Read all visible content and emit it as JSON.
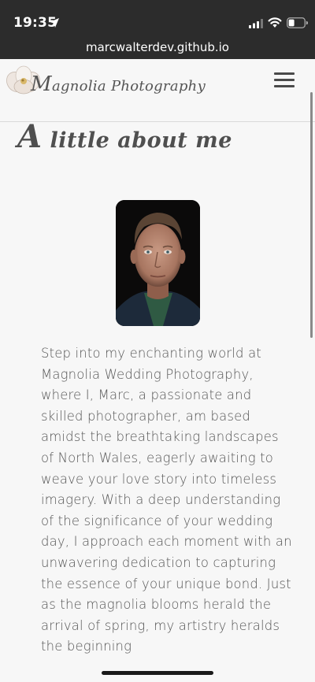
{
  "status_bar": {
    "time": "19:35",
    "icons": [
      "location-arrow-icon",
      "signal-icon",
      "wifi-icon",
      "battery-icon"
    ]
  },
  "browser": {
    "url": "marcwalterdev.github.io"
  },
  "header": {
    "logo_text_cap": "M",
    "logo_text_rest": "agnolia Photography",
    "menu_icon": "hamburger-menu-icon"
  },
  "about": {
    "title_cap": "A",
    "title_rest": " little about me",
    "bio": "Step into my enchanting world at Magnolia Wedding Photography, where I, Marc, a passionate and skilled photographer, am based amidst the breathtaking landscapes of North Wales, eagerly awaiting to weave your love story into timeless imagery. With a deep understanding of the significance of your wedding day, I approach each moment with an unwavering dedication to capturing the essence of your unique bond. Just as the magnolia blooms herald the arrival of spring, my artistry heralds the beginning"
  },
  "colors": {
    "status_bar_bg": "#2c2c2c",
    "page_bg": "#f7f7f7",
    "text": "#555555"
  }
}
